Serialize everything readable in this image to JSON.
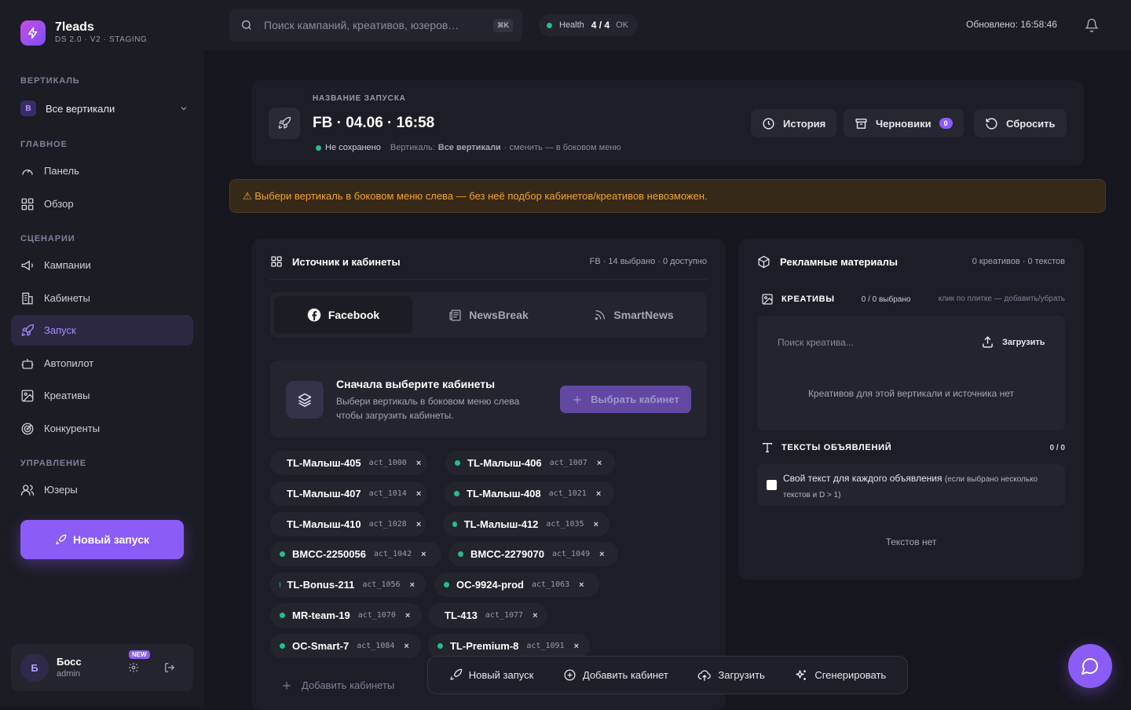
{
  "app": {
    "name": "7leads",
    "subtitle": "DS 2.0 · V2 · STAGING"
  },
  "sidebar": {
    "vertical_section": "ВЕРТИКАЛЬ",
    "vertical_badge": "В",
    "vertical_value": "Все вертикали",
    "sections": {
      "main": "ГЛАВНОЕ",
      "scenarios": "СЦЕНАРИИ",
      "management": "УПРАВЛЕНИЕ"
    },
    "items": [
      {
        "label": "Панель",
        "icon": "gauge-icon"
      },
      {
        "label": "Обзор",
        "icon": "grid-icon"
      },
      {
        "label": "Кампании",
        "icon": "megaphone-icon"
      },
      {
        "label": "Кабинеты",
        "icon": "building-icon"
      },
      {
        "label": "Запуск",
        "icon": "rocket-icon",
        "active": true
      },
      {
        "label": "Автопилот",
        "icon": "bot-icon"
      },
      {
        "label": "Креативы",
        "icon": "image-icon"
      },
      {
        "label": "Конкуренты",
        "icon": "radar-icon"
      },
      {
        "label": "Юзеры",
        "icon": "users-icon"
      }
    ],
    "new_launch_button": "Новый запуск",
    "user": {
      "initial": "Б",
      "name": "Босс",
      "role": "admin",
      "new_tag": "NEW"
    }
  },
  "topbar": {
    "search_placeholder": "Поиск кампаний, креативов, юзеров…",
    "shortcut": "⌘K",
    "health_label": "Health",
    "health_value": "4 / 4",
    "health_status": "OK",
    "updated": "Обновлено: 16:58:46"
  },
  "launch": {
    "label": "НАЗВАНИЕ ЗАПУСКА",
    "title": "FB · 04.06 · 16:58",
    "status": "Не сохранено",
    "vertical_prefix": "Вертикаль:",
    "vertical_value": "Все вертикали",
    "vertical_hint": "· сменить — в боковом меню",
    "buttons": {
      "history": "История",
      "drafts": "Черновики",
      "drafts_count": "0",
      "reset": "Сбросить"
    }
  },
  "warning": "⚠ Выбери вертикаль в боковом меню слева — без неё подбор кабинетов/креативов невозможен.",
  "sources": {
    "title": "Источник и кабинеты",
    "meta": "FB · 14 выбрано · 0 доступно",
    "tabs": [
      {
        "label": "Facebook",
        "active": true
      },
      {
        "label": "NewsBreak"
      },
      {
        "label": "SmartNews"
      }
    ],
    "empty_title": "Сначала выберите кабинеты",
    "empty_desc": "Выбери вертикаль в боковом меню слева чтобы загрузить кабинеты.",
    "select_button": "Выбрать кабинет",
    "chips": [
      {
        "name": "TL-Малыш-405",
        "act": "act_1000"
      },
      {
        "name": "TL-Малыш-406",
        "act": "act_1007"
      },
      {
        "name": "TL-Малыш-407",
        "act": "act_1014"
      },
      {
        "name": "TL-Малыш-408",
        "act": "act_1021"
      },
      {
        "name": "TL-Малыш-410",
        "act": "act_1028"
      },
      {
        "name": "TL-Малыш-412",
        "act": "act_1035"
      },
      {
        "name": "BMCC-2250056",
        "act": "act_1042"
      },
      {
        "name": "BMCC-2279070",
        "act": "act_1049"
      },
      {
        "name": "TL-Bonus-211",
        "act": "act_1056"
      },
      {
        "name": "OC-9924-prod",
        "act": "act_1063"
      },
      {
        "name": "MR-team-19",
        "act": "act_1070"
      },
      {
        "name": "TL-413",
        "act": "act_1077"
      },
      {
        "name": "OC-Smart-7",
        "act": "act_1084"
      },
      {
        "name": "TL-Premium-8",
        "act": "act_1091"
      }
    ],
    "remove_glyph": "×",
    "add_cabinets": "Добавить кабинеты"
  },
  "materials": {
    "title": "Рекламные материалы",
    "meta": "0 креативов · 0 текстов",
    "creatives_label": "КРЕАТИВЫ",
    "creatives_count": "0 / 0 выбрано",
    "creatives_hint": "клик по плитке — добавить/убрать",
    "search_placeholder": "Поиск креатива...",
    "upload": "Загрузить",
    "creatives_empty": "Креативов для этой вертикали и источника нет",
    "texts_label": "ТЕКСТЫ ОБЪЯВЛЕНИЙ",
    "texts_count": "0 / 0",
    "own_text_main": " Свой текст для каждого объявления",
    "own_text_hint": "(если выбрано несколько текстов и D > 1)",
    "texts_empty": "Текстов нет"
  },
  "bottombar": {
    "new_launch": "Новый запуск",
    "add_cabinet": "Добавить кабинет",
    "upload": "Загрузить",
    "generate": "Сгенерировать"
  },
  "colors": {
    "accent": "#8b5cf6",
    "success": "#22c08a",
    "warning": "#f3a32f"
  }
}
